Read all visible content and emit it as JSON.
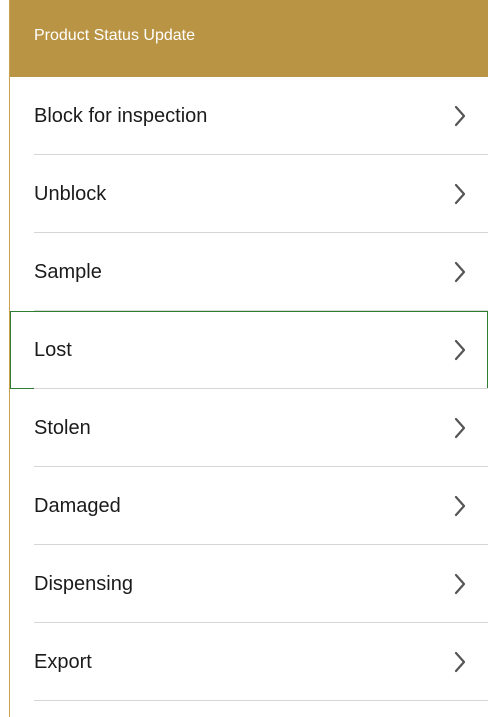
{
  "header": {
    "title": "Product Status Update"
  },
  "menu": {
    "items": [
      {
        "label": "Block for inspection",
        "icon": "chevron-right-icon",
        "focused": false
      },
      {
        "label": "Unblock",
        "icon": "chevron-right-icon",
        "focused": false
      },
      {
        "label": "Sample",
        "icon": "chevron-right-icon",
        "focused": false
      },
      {
        "label": "Lost",
        "icon": "chevron-right-icon",
        "focused": true
      },
      {
        "label": "Stolen",
        "icon": "chevron-right-icon",
        "focused": false
      },
      {
        "label": "Damaged",
        "icon": "chevron-right-icon",
        "focused": false
      },
      {
        "label": "Dispensing",
        "icon": "chevron-right-icon",
        "focused": false
      },
      {
        "label": "Export",
        "icon": "chevron-right-icon",
        "focused": false
      }
    ]
  },
  "colors": {
    "header_bg": "#b99445",
    "header_text": "#ffffff",
    "focus_border": "#2e7d32",
    "separator": "#d6d6d6"
  }
}
